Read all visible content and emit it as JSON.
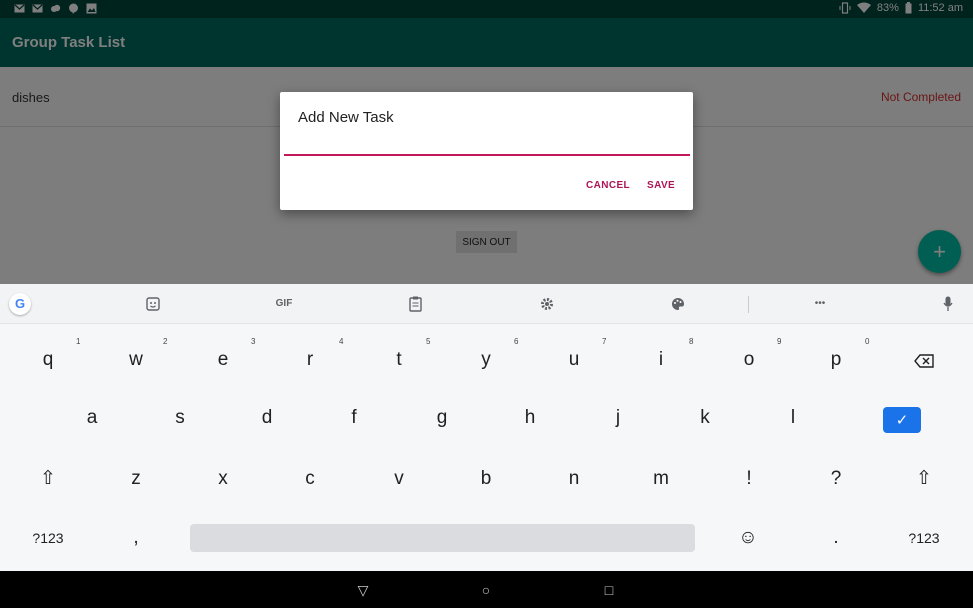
{
  "status_bar": {
    "battery_percent": "83%",
    "time": "11:52 am",
    "left_icons": [
      "gmail-icon",
      "gmail-icon",
      "weather-icon",
      "hangouts-icon",
      "image-icon"
    ],
    "right_icons": [
      "vibrate-icon",
      "wifi-icon",
      "battery-icon"
    ]
  },
  "app_bar": {
    "title": "Group Task List"
  },
  "tasks": [
    {
      "name": "dishes",
      "status": "Not Completed"
    }
  ],
  "sign_out_label": "SIGN OUT",
  "fab_label": "+",
  "dialog": {
    "title": "Add New Task",
    "input_value": "",
    "cancel_label": "CANCEL",
    "save_label": "SAVE"
  },
  "keyboard": {
    "toolbar": {
      "google_label": "G",
      "gif_label": "GIF",
      "more_label": "•••"
    },
    "row1": [
      "q",
      "w",
      "e",
      "r",
      "t",
      "y",
      "u",
      "i",
      "o",
      "p"
    ],
    "row1_hints": [
      "1",
      "2",
      "3",
      "4",
      "5",
      "6",
      "7",
      "8",
      "9",
      "0"
    ],
    "row2": [
      "a",
      "s",
      "d",
      "f",
      "g",
      "h",
      "j",
      "k",
      "l"
    ],
    "row3": [
      "z",
      "x",
      "c",
      "v",
      "b",
      "n",
      "m",
      "!",
      "?"
    ],
    "symbols_label": "?123",
    "comma_label": ",",
    "period_label": ".",
    "enter_symbol": "✓",
    "shift_symbol": "⇧",
    "backspace_symbol": "⌫",
    "emoji_symbol": "☺"
  },
  "nav_bar": {
    "back_symbol": "▽",
    "home_symbol": "○",
    "recents_symbol": "□"
  },
  "colors": {
    "status_bar": "#00463a",
    "app_bar": "#00695c",
    "accent": "#c2185b",
    "not_completed": "#d32f2f",
    "fab": "#00bfa5",
    "enter_key": "#1a73e8"
  }
}
